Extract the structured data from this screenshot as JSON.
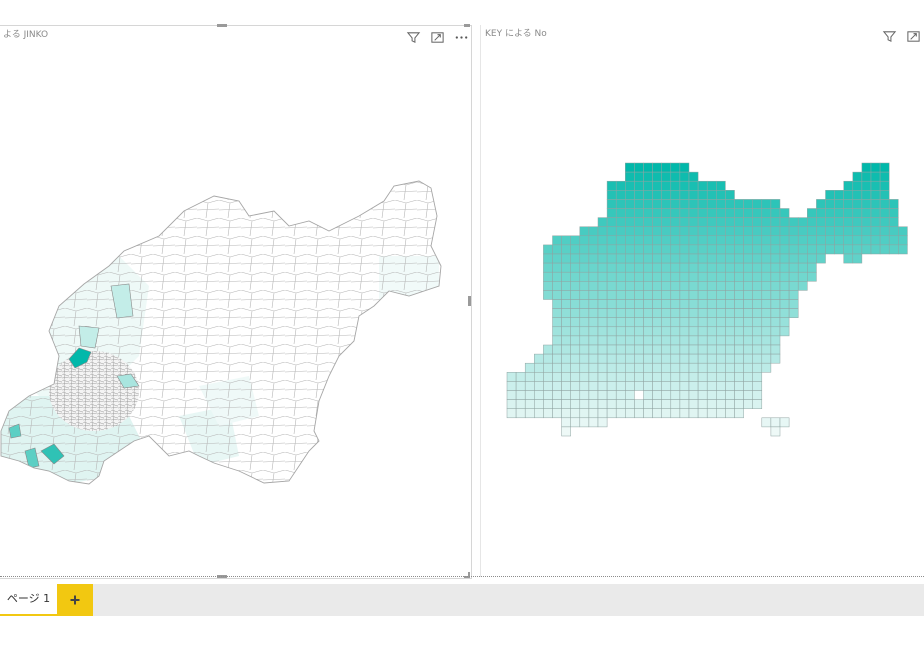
{
  "visuals": {
    "left": {
      "title": "よる JINKO"
    },
    "right": {
      "title": "KEY による No"
    }
  },
  "icons": {
    "filter": "filter-icon",
    "focus": "focus-mode-icon",
    "more": "more-options-icon",
    "add": "plus-icon"
  },
  "colors": {
    "accent": "#f2c811",
    "map_high": "#01b8aa",
    "map_low": "#e8f8f6",
    "border": "#a6a6a6"
  },
  "pages": {
    "tabs": [
      {
        "label": "ページ 1"
      }
    ]
  }
}
